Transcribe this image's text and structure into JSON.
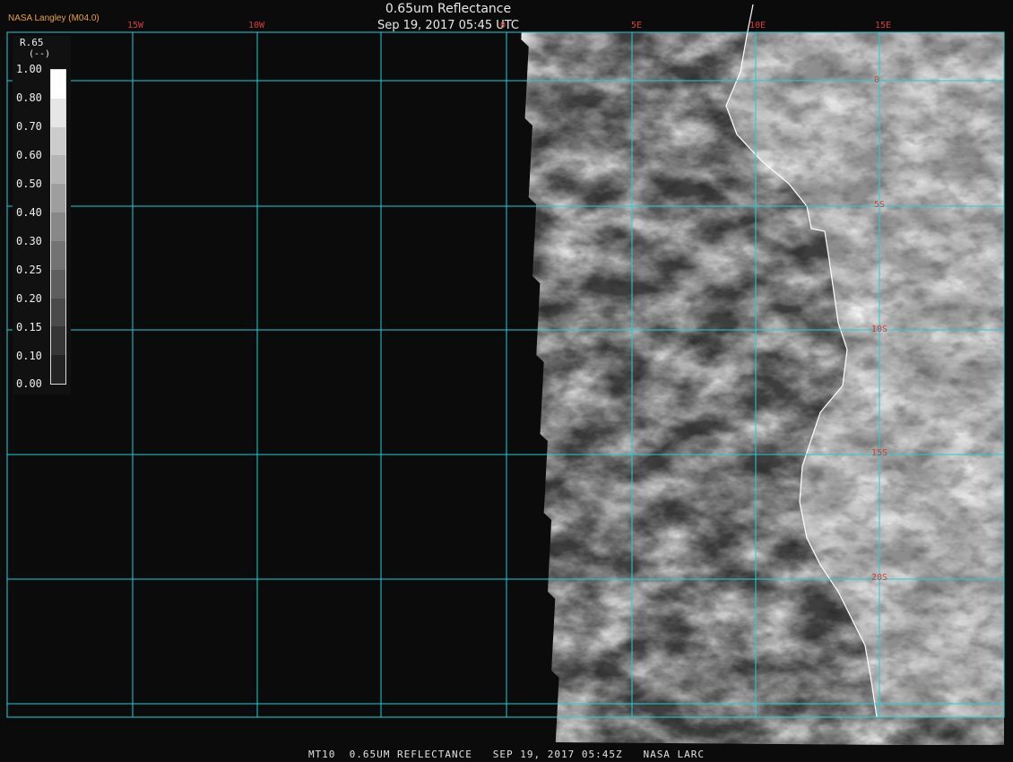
{
  "header": {
    "agency": "NASA Langley (M04.0)",
    "title": "0.65um Reflectance",
    "subtitle": "Sep 19, 2017 05:45 UTC"
  },
  "longitude_labels": [
    "15W",
    "10W",
    "0",
    "5E",
    "10E",
    "15E"
  ],
  "latitude_labels": [
    "0",
    "5S",
    "10S",
    "15S",
    "20S"
  ],
  "legend": {
    "title": "R.65",
    "units": "(--)",
    "ticks": [
      "1.00",
      "0.80",
      "0.70",
      "0.60",
      "0.50",
      "0.40",
      "0.30",
      "0.25",
      "0.20",
      "0.15",
      "0.10",
      "0.00"
    ]
  },
  "footer": "MT10  0.65UM REFLECTANCE   SEP 19, 2017 05:45Z   NASA LARC",
  "colors": {
    "grid": "#1ecfd6",
    "label_red": "#d63c3c",
    "agency_orange": "#e8a23a",
    "background": "#0b0b0b",
    "coastline": "#ffffff"
  }
}
